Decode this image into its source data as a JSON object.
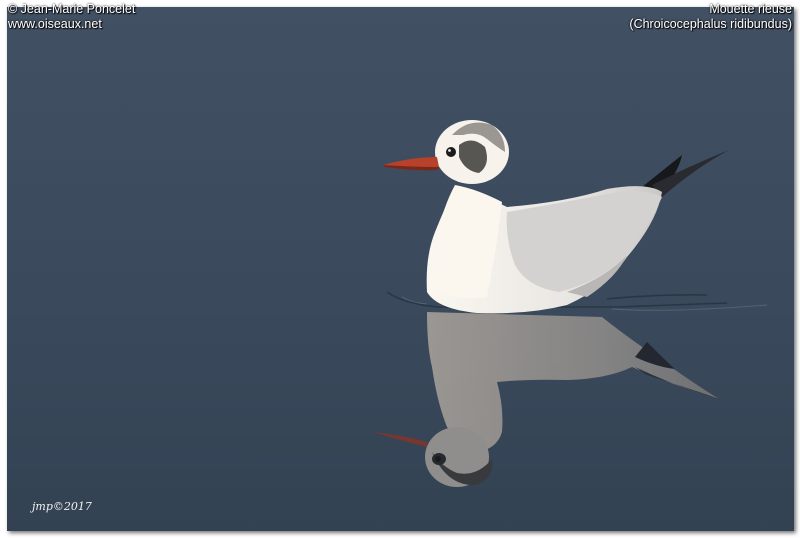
{
  "credits": {
    "photographer": "© Jean-Marie Poncelet",
    "website": "www.oiseaux.net"
  },
  "species": {
    "common_name": "Mouette rieuse",
    "scientific_name": "(Chroicocephalus ridibundus)"
  },
  "signature": "jmp©2017",
  "colors": {
    "water_top": "#3f4d5e",
    "water_bottom": "#344455",
    "gull_white": "#f1efe9",
    "gull_grey": "#c9c8c6",
    "bill_red": "#b3402b"
  }
}
